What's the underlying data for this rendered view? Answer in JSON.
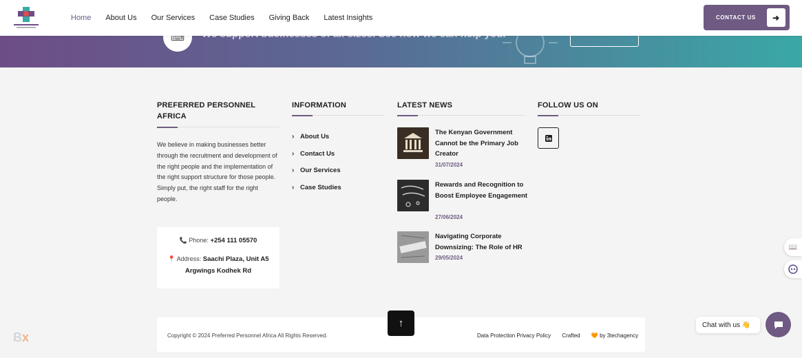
{
  "header": {
    "nav": [
      "Home",
      "About Us",
      "Our Services",
      "Case Studies",
      "Giving Back",
      "Latest Insights"
    ],
    "active_nav": "Home",
    "contact_label": "CONTACT US",
    "contact_arrow": "➜"
  },
  "banner": {
    "text": "We support businesses of all sizes. See how we can help you."
  },
  "company": {
    "title": "PREFERRED PERSONNEL AFRICA",
    "description": "We believe in making businesses better through the recruitment and development of the right people and the implementation of the right support structure for those people. Simply put, the right staff for the right people.",
    "phone_label": "Phone:",
    "phone": "+254 111 05570",
    "address_label": "Address:",
    "address": "Saachi Plaza, Unit A5 Argwings Kodhek Rd"
  },
  "information": {
    "title": "INFORMATION",
    "links": [
      "About Us",
      "Contact Us",
      "Our Services",
      "Case Studies"
    ]
  },
  "news": {
    "title": "LATEST NEWS",
    "items": [
      {
        "title": "The Kenyan Government Cannot be the Primary Job Creator",
        "date": "31/07/2024"
      },
      {
        "title": "Rewards and Recognition to Boost Employee Engagement",
        "date": "27/06/2024"
      },
      {
        "title": "Navigating Corporate Downsizing: The Role of HR",
        "date": "29/05/2024"
      }
    ]
  },
  "follow": {
    "title": "FOLLOW US ON",
    "icon": "linkedin-icon"
  },
  "bottom": {
    "copyright": "Copyright © 2024 Preferred Personnel Africa All Rights Reserved.",
    "link1": "Data Protection Privacy Policy",
    "crafted_prefix": "Crafted",
    "crafted_suffix": "by 3techagency"
  },
  "chat": {
    "label": "Chat with us 👋"
  },
  "colors": {
    "accent": "#6e5a82",
    "banner_start": "#6e4d86",
    "banner_end": "#3aa8a6"
  }
}
